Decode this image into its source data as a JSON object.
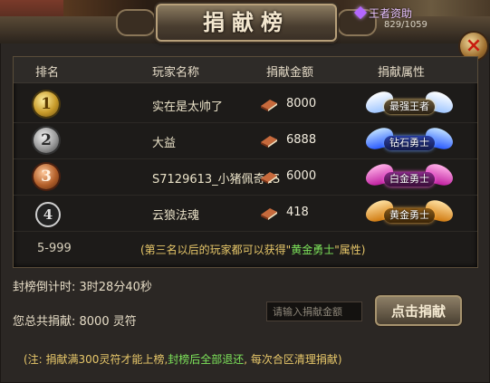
{
  "window": {
    "title": "捐献榜",
    "close_label": "×"
  },
  "vip": {
    "label": "王者资助",
    "count": "829/1059"
  },
  "table": {
    "headers": [
      "排名",
      "玩家名称",
      "捐献金额",
      "捐献属性"
    ],
    "rows": [
      {
        "rank": "1",
        "name": "实在是太帅了",
        "amount": "8000",
        "attr": "最强王者"
      },
      {
        "rank": "2",
        "name": "大益",
        "amount": "6888",
        "attr": "钻石勇士"
      },
      {
        "rank": "3",
        "name": "S7129613_小猪佩奇1S",
        "amount": "6000",
        "attr": "白金勇士"
      },
      {
        "rank": "4",
        "name": "云狼法魂",
        "amount": "418",
        "attr": "黄金勇士"
      }
    ],
    "tail": {
      "rank": "5-999",
      "note_pre": "(第三名以后的玩家都可以获得\"",
      "note_hl": "黄金勇士",
      "note_post": "\"属性)"
    }
  },
  "countdown": "封榜倒计时: 3时28分40秒",
  "total": "您总共捐献: 8000 灵符",
  "input": {
    "placeholder": "请输入捐献金额"
  },
  "donate_button": "点击捐献",
  "footnote": {
    "pre": "(注: 捐献满300灵符才能上榜,",
    "hl": "封榜后全部退还",
    "post": ", 每次合区清理捐献)"
  },
  "colors": {
    "note_yellow": "#e8c86a",
    "highlight_green": "#7de35a"
  }
}
